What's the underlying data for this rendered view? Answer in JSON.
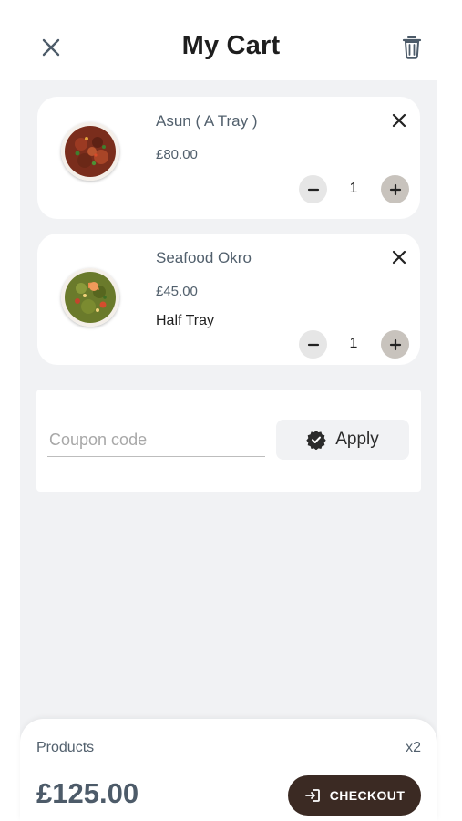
{
  "header": {
    "title": "My Cart",
    "close_icon": "close-icon",
    "delete_icon": "trash-icon"
  },
  "cart": {
    "items": [
      {
        "name": "Asun ( A Tray )",
        "price": "£80.00",
        "quantity": "1",
        "image": "grilled-goat-meat-photo"
      },
      {
        "name": "Seafood Okro",
        "price": "£45.00",
        "variant": "Half Tray",
        "quantity": "1",
        "image": "seafood-okro-photo"
      }
    ]
  },
  "coupon": {
    "placeholder": "Coupon code",
    "value": "",
    "apply_label": "Apply",
    "apply_icon": "verified-badge-icon"
  },
  "summary": {
    "products_label": "Products",
    "products_count": "x2",
    "total": "£125.00",
    "checkout_label": "CHECKOUT",
    "checkout_icon": "login-arrow-icon"
  },
  "colors": {
    "background": "#f1f2f4",
    "card": "#ffffff",
    "text_muted": "#52606d",
    "checkout_button": "#3b2a23",
    "plus_button": "#c8c3bd",
    "minus_button": "#e6e6e6"
  }
}
